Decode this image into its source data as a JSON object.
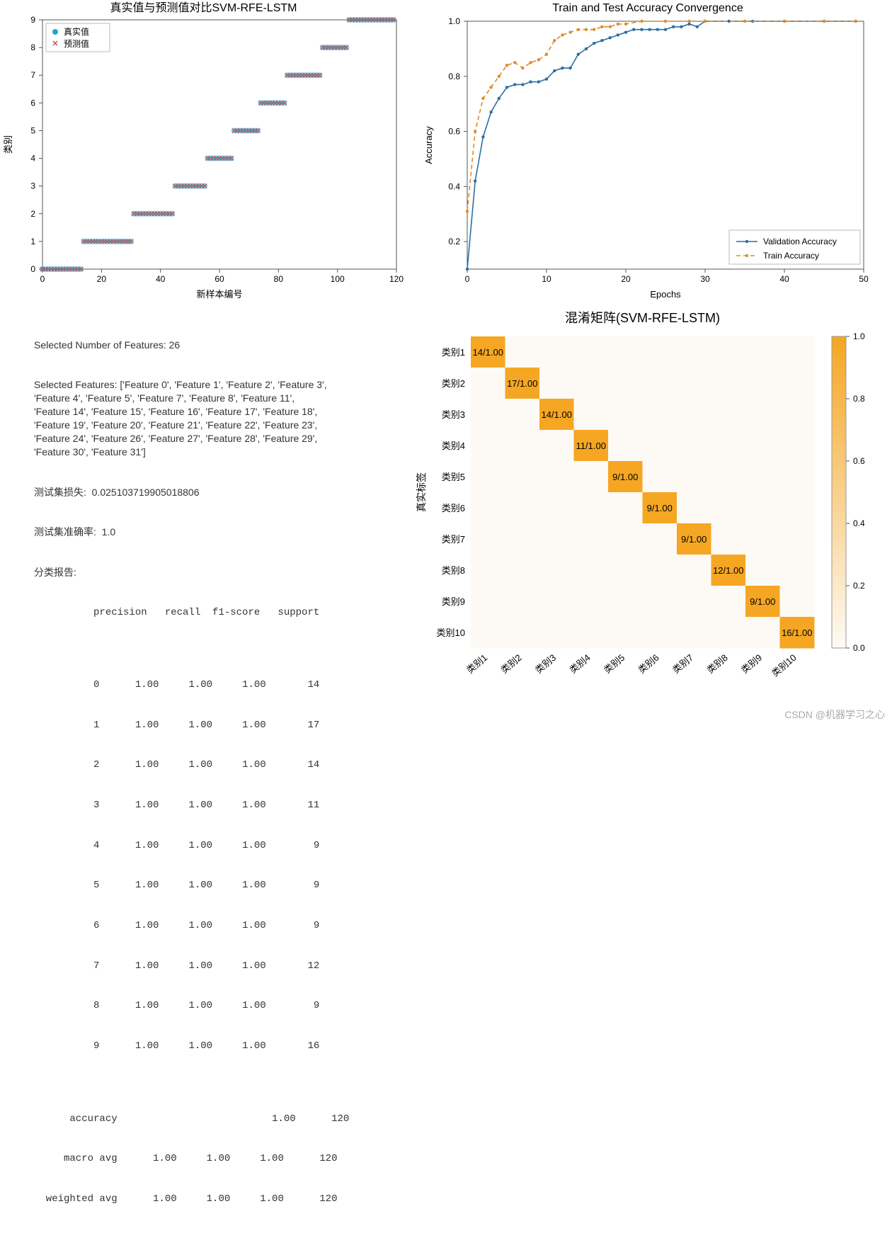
{
  "watermark": "CSDN @机器学习之心",
  "report": {
    "num_features_line": "Selected Number of Features: 26",
    "selected_features_line": "Selected Features: ['Feature 0', 'Feature 1', 'Feature 2', 'Feature 3',\n'Feature 4', 'Feature 5', 'Feature 7', 'Feature 8', 'Feature 11',\n'Feature 14', 'Feature 15', 'Feature 16', 'Feature 17', 'Feature 18',\n'Feature 19', 'Feature 20', 'Feature 21', 'Feature 22', 'Feature 23',\n'Feature 24', 'Feature 26', 'Feature 27', 'Feature 28', 'Feature 29',\n'Feature 30', 'Feature 31']",
    "test_loss_line": "测试集损失:  0.025103719905018806",
    "test_acc_line": "测试集准确率:  1.0",
    "cls_header": "分类报告:",
    "table_header": "          precision   recall  f1-score   support",
    "rows": [
      "          0      1.00     1.00     1.00       14",
      "          1      1.00     1.00     1.00       17",
      "          2      1.00     1.00     1.00       14",
      "          3      1.00     1.00     1.00       11",
      "          4      1.00     1.00     1.00        9",
      "          5      1.00     1.00     1.00        9",
      "          6      1.00     1.00     1.00        9",
      "          7      1.00     1.00     1.00       12",
      "          8      1.00     1.00     1.00        9",
      "          9      1.00     1.00     1.00       16"
    ],
    "accuracy_line": "      accuracy                          1.00      120",
    "macro_line": "     macro avg      1.00     1.00     1.00      120",
    "weighted_line": "  weighted avg      1.00     1.00     1.00      120"
  },
  "chart_data": [
    {
      "id": "scatter",
      "type": "scatter",
      "title": "真实值与预测值对比SVM-RFE-LSTM",
      "xlabel": "新样本编号",
      "ylabel": "类别",
      "xlim": [
        0,
        120
      ],
      "ylim": [
        0,
        9
      ],
      "xticks": [
        0,
        20,
        40,
        60,
        80,
        100,
        120
      ],
      "yticks": [
        0,
        1,
        2,
        3,
        4,
        5,
        6,
        7,
        8,
        9
      ],
      "legend": [
        "真实值",
        "预测值"
      ],
      "segments": [
        {
          "class": 0,
          "start": 0,
          "end": 13
        },
        {
          "class": 1,
          "start": 14,
          "end": 30
        },
        {
          "class": 2,
          "start": 31,
          "end": 44
        },
        {
          "class": 3,
          "start": 45,
          "end": 55
        },
        {
          "class": 4,
          "start": 56,
          "end": 64
        },
        {
          "class": 5,
          "start": 65,
          "end": 73
        },
        {
          "class": 6,
          "start": 74,
          "end": 82
        },
        {
          "class": 7,
          "start": 83,
          "end": 94
        },
        {
          "class": 8,
          "start": 95,
          "end": 103
        },
        {
          "class": 9,
          "start": 104,
          "end": 119
        }
      ],
      "colors": {
        "true": "#1fa6d4",
        "pred": "#b55"
      }
    },
    {
      "id": "convergence",
      "type": "line",
      "title": "Train and Test Accuracy Convergence",
      "xlabel": "Epochs",
      "ylabel": "Accuracy",
      "xlim": [
        0,
        50
      ],
      "ylim": [
        0.1,
        1.0
      ],
      "xticks": [
        0,
        10,
        20,
        30,
        40,
        50
      ],
      "yticks": [
        0.2,
        0.4,
        0.6,
        0.8,
        1.0
      ],
      "series": [
        {
          "name": "Validation Accuracy",
          "color": "#2b6fa3",
          "dash": false,
          "x": [
            0,
            1,
            2,
            3,
            4,
            5,
            6,
            7,
            8,
            9,
            10,
            11,
            12,
            13,
            14,
            15,
            16,
            17,
            18,
            19,
            20,
            21,
            22,
            23,
            24,
            25,
            26,
            27,
            28,
            29,
            30,
            33,
            36,
            40,
            45,
            49
          ],
          "y": [
            0.1,
            0.42,
            0.58,
            0.67,
            0.72,
            0.76,
            0.77,
            0.77,
            0.78,
            0.78,
            0.79,
            0.82,
            0.83,
            0.83,
            0.88,
            0.9,
            0.92,
            0.93,
            0.94,
            0.95,
            0.96,
            0.97,
            0.97,
            0.97,
            0.97,
            0.97,
            0.98,
            0.98,
            0.99,
            0.98,
            1.0,
            1.0,
            1.0,
            1.0,
            1.0,
            1.0
          ]
        },
        {
          "name": "Train Accuracy",
          "color": "#e08a2a",
          "dash": true,
          "x": [
            0,
            1,
            2,
            3,
            4,
            5,
            6,
            7,
            8,
            9,
            10,
            11,
            12,
            13,
            14,
            15,
            16,
            17,
            18,
            19,
            20,
            22,
            25,
            28,
            30,
            35,
            40,
            45,
            49
          ],
          "y": [
            0.31,
            0.6,
            0.72,
            0.76,
            0.8,
            0.84,
            0.85,
            0.83,
            0.85,
            0.86,
            0.88,
            0.93,
            0.95,
            0.96,
            0.97,
            0.97,
            0.97,
            0.98,
            0.98,
            0.99,
            0.99,
            1.0,
            1.0,
            1.0,
            1.0,
            1.0,
            1.0,
            1.0,
            1.0
          ]
        }
      ]
    },
    {
      "id": "confusion",
      "type": "heatmap",
      "title": "混淆矩阵(SVM-RFE-LSTM)",
      "xlabel": "",
      "ylabel": "真实标签",
      "categories": [
        "类别1",
        "类别2",
        "类别3",
        "类别4",
        "类别5",
        "类别6",
        "类别7",
        "类别8",
        "类别9",
        "类别10"
      ],
      "values": [
        14,
        17,
        14,
        11,
        9,
        9,
        9,
        12,
        9,
        16
      ],
      "cell_label_format": "{v}/1.00",
      "colorbar_ticks": [
        0.0,
        0.2,
        0.4,
        0.6,
        0.8,
        1.0
      ],
      "color_max": "#f5a623",
      "color_min": "#fdfaf5"
    }
  ]
}
